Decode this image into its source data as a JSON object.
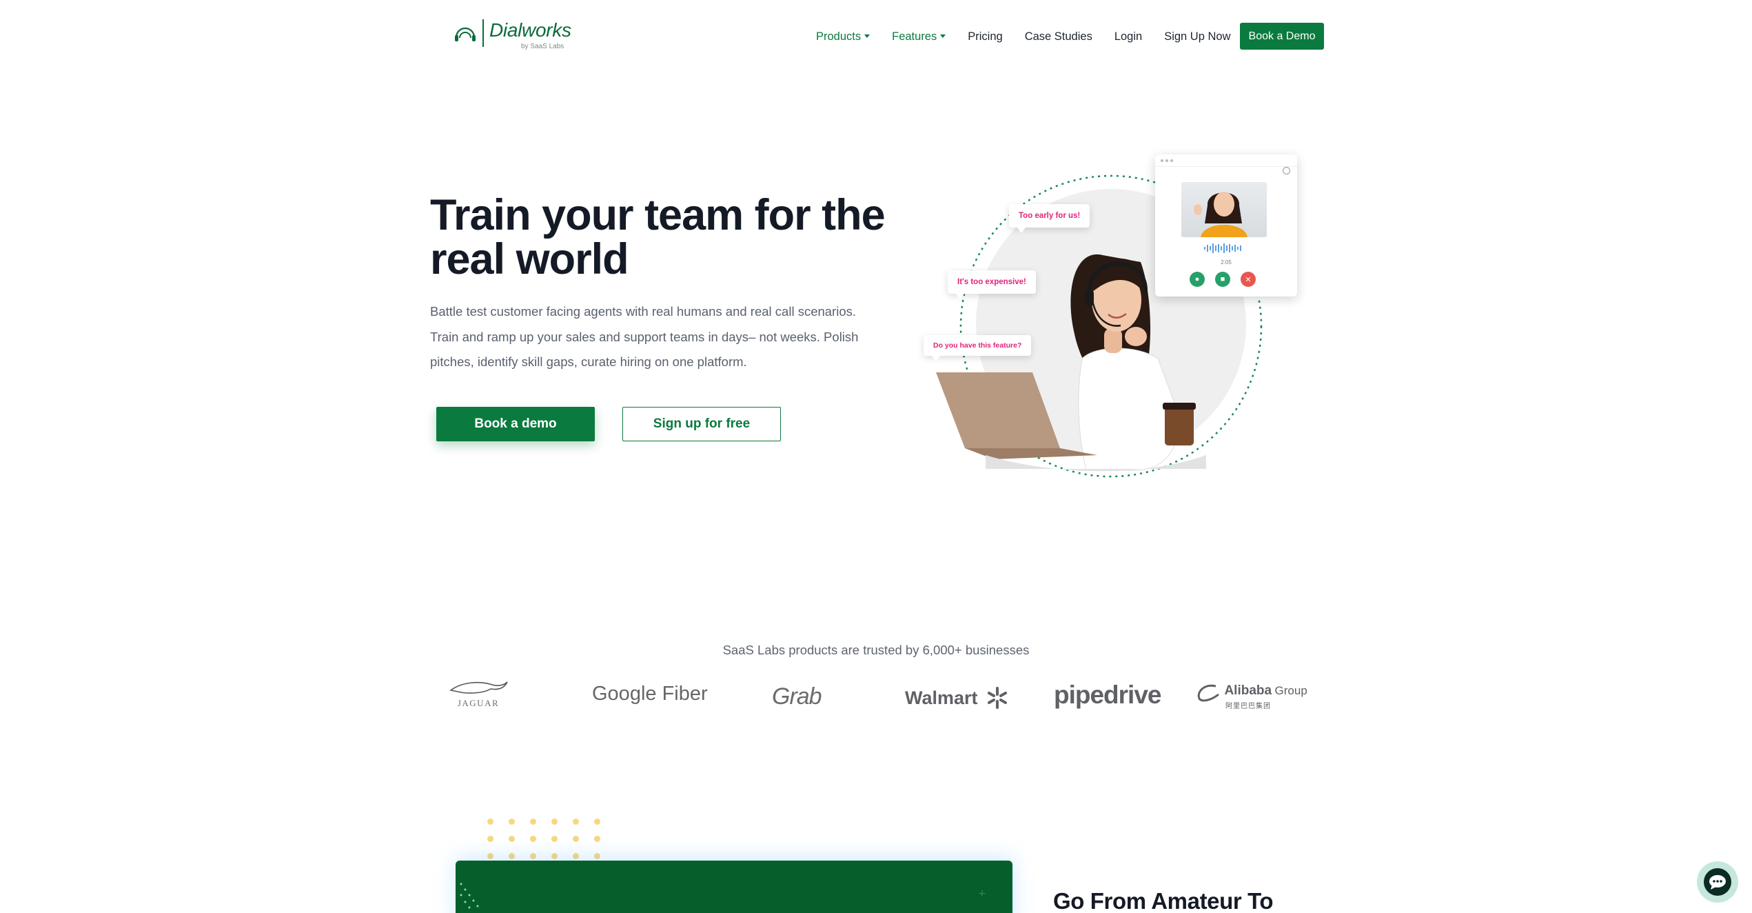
{
  "brand": {
    "name": "Dialworks",
    "sub": "by SaaS Labs"
  },
  "nav": {
    "items": [
      {
        "label": "Products",
        "dropdown": true,
        "accent": true
      },
      {
        "label": "Features",
        "dropdown": true,
        "accent": true
      },
      {
        "label": "Pricing",
        "dropdown": false,
        "accent": false
      },
      {
        "label": "Case Studies",
        "dropdown": false,
        "accent": false
      },
      {
        "label": "Login",
        "dropdown": false,
        "accent": false
      },
      {
        "label": "Sign Up Now",
        "dropdown": false,
        "accent": false
      }
    ],
    "cta": "Book a Demo"
  },
  "hero": {
    "title_line1": "Train your team for the",
    "title_line2": "real world",
    "desc_line1": "Battle test customer facing agents with real humans and real call scenarios.",
    "desc_line2": "Train and ramp up your sales and support teams in days– not weeks. Polish",
    "desc_line3": "pitches, identify skill gaps, curate hiring on one platform.",
    "primary_cta": "Book a demo",
    "secondary_cta": "Sign up for free"
  },
  "illustration": {
    "bubbles": [
      "Too early for us!",
      "It's too expensive!",
      "Do you have this feature?"
    ],
    "call_time": "2:05"
  },
  "trusted": {
    "caption": "SaaS Labs products are trusted by 6,000+ businesses",
    "logos": [
      "JAGUAR",
      "Google Fiber",
      "Grab",
      "Walmart",
      "pipedrive",
      "Alibaba",
      "Group",
      "阿里巴巴集团"
    ]
  },
  "next_section": {
    "title": "Go From Amateur To"
  },
  "colors": {
    "primary": "#0b7a3e",
    "dark_green": "#055f2b",
    "bubble_text": "#e0247a",
    "dots": "#f9d77e"
  }
}
